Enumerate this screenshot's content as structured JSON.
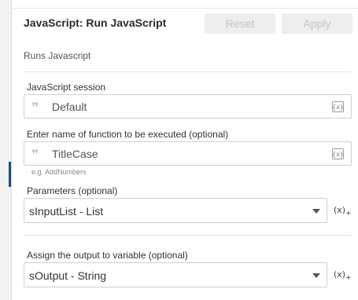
{
  "header": {
    "title": "JavaScript: Run JavaScript",
    "reset_label": "Reset",
    "apply_label": "Apply"
  },
  "description": "Runs Javascript",
  "session": {
    "label": "JavaScript session",
    "value": "Default",
    "quote_glyph": "❞",
    "var_glyph": "{x}"
  },
  "function": {
    "label": "Enter name of function to be executed (optional)",
    "value": "TitleCase",
    "hint": "e.g. AddNumbers",
    "quote_glyph": "❞",
    "var_glyph": "{x}"
  },
  "parameters": {
    "label": "Parameters (optional)",
    "value": "sInputList - List",
    "fx_glyph": "(x)",
    "fx_plus": "+"
  },
  "output": {
    "label": "Assign the output to variable (optional)",
    "value": "sOutput - String",
    "fx_glyph": "(x)",
    "fx_plus": "+"
  },
  "colors": {
    "accent": "#1f4f7a",
    "button_bg": "#eeeeee",
    "button_text": "#c2c2c2"
  }
}
